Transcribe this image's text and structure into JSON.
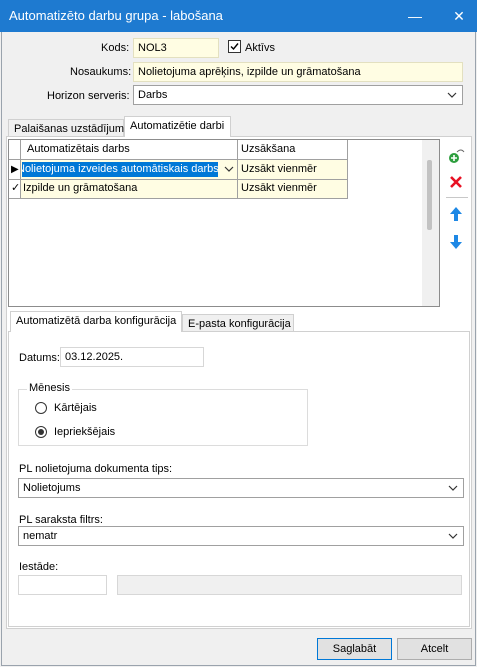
{
  "window": {
    "title": "Automatizēto darbu grupa - labošana",
    "minimize": "—",
    "close": "✕"
  },
  "header": {
    "kods_label": "Kods:",
    "kods_value": "NOL3",
    "aktivs_label": "Aktīvs",
    "aktivs_checked": true,
    "nosaukums_label": "Nosaukums:",
    "nosaukums_value": "Nolietojuma aprēķins, izpilde un grāmatošana",
    "horizon_label": "Horizon serveris:",
    "horizon_value": "Darbs"
  },
  "tabs": [
    {
      "label": "Palaišanas uzstādījumi",
      "active": false
    },
    {
      "label": "Automatizētie darbi",
      "active": true
    }
  ],
  "jobs_table": {
    "columns": [
      "Automatizētais darbs",
      "Uzsākšana"
    ],
    "rows": [
      {
        "indicator": "▶",
        "darbs": "Nolietojuma izveides automātiskais darbs",
        "uzsaksana": "Uzsākt vienmēr",
        "selected": true
      },
      {
        "indicator": "✓",
        "darbs": "Izpilde un grāmatošana",
        "uzsaksana": "Uzsākt vienmēr",
        "selected": false
      }
    ]
  },
  "side_buttons": [
    "add-icon",
    "delete-icon",
    "move-up-icon",
    "move-down-icon"
  ],
  "config_tabs": [
    {
      "label": "Automatizētā darba konfigurācija",
      "active": true
    },
    {
      "label": "E-pasta konfigurācija",
      "active": false
    }
  ],
  "config": {
    "datums_label": "Datums:",
    "datums_value": "03.12.2025.",
    "menesis_group": "Mēnesis",
    "radio_options": [
      {
        "label": "Kārtējais",
        "checked": false
      },
      {
        "label": "Iepriekšējais",
        "checked": true
      }
    ],
    "pl_doc_type_label": "PL nolietojuma dokumenta tips:",
    "pl_doc_type_value": "Nolietojums",
    "pl_filter_label": "PL saraksta filtrs:",
    "pl_filter_value": "nematr",
    "iestade_label": "Iestāde:",
    "iestade_code": "",
    "iestade_name": ""
  },
  "footer": {
    "save": "Saglabāt",
    "cancel": "Atcelt"
  },
  "colors": {
    "titlebar": "#1e7ad0",
    "selection": "#0078d7",
    "input_highlight": "#fffde3",
    "delete_red": "#e81123",
    "arrow_blue": "#1e88e5",
    "add_green": "#2e9e3e"
  }
}
